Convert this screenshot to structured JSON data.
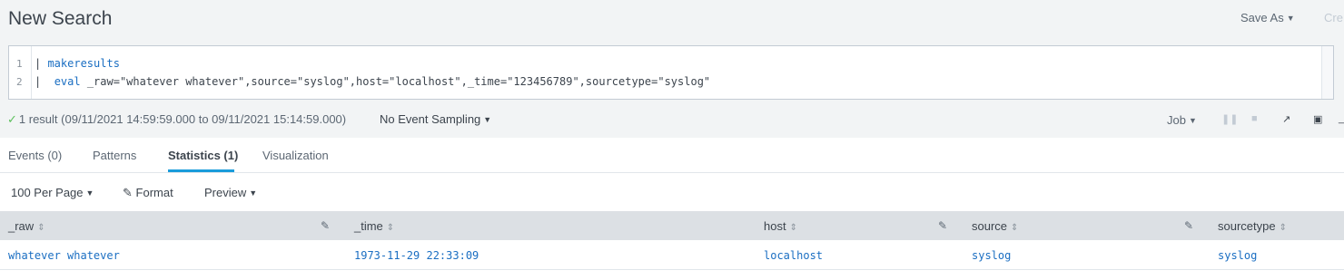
{
  "header": {
    "title": "New Search",
    "save_as": "Save As",
    "create": "Cre"
  },
  "search": {
    "line_numbers": [
      "1",
      "2"
    ],
    "lines": [
      {
        "pipe": "| ",
        "command": "makeresults",
        "rest": ""
      },
      {
        "pipe": "|  ",
        "command": "eval",
        "rest": " _raw=\"whatever whatever\",source=\"syslog\",host=\"localhost\",_time=\"123456789\",sourcetype=\"syslog\""
      }
    ]
  },
  "status": {
    "check_icon": "✓",
    "result_text": "1 result (09/11/2021 14:59:59.000 to 09/11/2021 15:14:59.000)",
    "sampling": "No Event Sampling",
    "job": "Job"
  },
  "tabs": [
    {
      "label": "Events (0)",
      "active": false
    },
    {
      "label": "Patterns",
      "active": false
    },
    {
      "label": "Statistics (1)",
      "active": true
    },
    {
      "label": "Visualization",
      "active": false
    }
  ],
  "toolbar": {
    "per_page": "100 Per Page",
    "format": "Format",
    "preview": "Preview"
  },
  "table": {
    "columns": [
      "_raw",
      "_time",
      "host",
      "source",
      "sourcetype"
    ],
    "rows": [
      [
        "whatever whatever",
        "1973-11-29 22:33:09",
        "localhost",
        "syslog",
        "syslog"
      ]
    ]
  },
  "colors": {
    "accent": "#1a9cdb",
    "link": "#1a6ec2",
    "success": "#5cc05c"
  }
}
